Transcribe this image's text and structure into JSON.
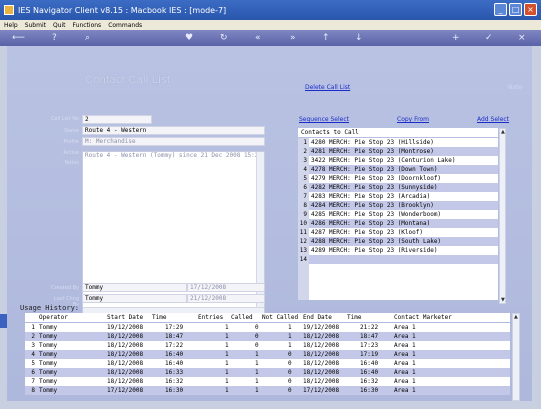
{
  "window": {
    "title": "IES Navigator Client v8.15 : Macbook IES :          [mode-7]"
  },
  "menu": [
    "Help",
    "Submit",
    "Quit",
    "Functions",
    "Commands"
  ],
  "toolbar_icons": [
    "back-icon",
    "help-icon",
    "search-icon",
    "heart-icon",
    "refresh-icon",
    "rewind-icon",
    "fast-forward-icon",
    "up-icon",
    "down-icon",
    "add-icon",
    "check-icon",
    "close-icon"
  ],
  "page": {
    "heading": "Contact Call List",
    "delete_link": "Delete Call List",
    "note_link": "Note"
  },
  "form": {
    "labels": {
      "call_list_no": "Call List No",
      "name": "Name",
      "profile": "Profile",
      "active_notes": "Active",
      "notes": "Notes",
      "created_by": "Created By",
      "last_changed_by": "Last Chng By"
    },
    "call_list_no": "2",
    "name": "Route 4 - Western",
    "profile": "M: Merchandise",
    "notes_line": "Route 4 - Western (Tommy) since 21 Dec 2008 15:25",
    "created_by": "Tommy",
    "created_date": "17/12/2008",
    "changed_by": "Tommy",
    "changed_date": "21/12/2008"
  },
  "contacts": {
    "sequence_link": "Sequence Select",
    "copy_link": "Copy From",
    "add_link": "Add Select",
    "header": "Contacts to Call",
    "rows": [
      {
        "n": "1",
        "text": "4280 MERCH: Pie Stop 23 (Hillside)"
      },
      {
        "n": "2",
        "text": "4281 MERCH: Pie Stop 23 (Montrose)"
      },
      {
        "n": "3",
        "text": "3422 MERCH: Pie Stop 23 (Centurion Lake)"
      },
      {
        "n": "4",
        "text": "4278 MERCH: Pie Stop 23 (Down Town)"
      },
      {
        "n": "5",
        "text": "4279 MERCH: Pie Stop 23 (Doornkloof)"
      },
      {
        "n": "6",
        "text": "4282 MERCH: Pie Stop 23 (Sunnyside)"
      },
      {
        "n": "7",
        "text": "4283 MERCH: Pie Stop 23 (Arcadia)"
      },
      {
        "n": "8",
        "text": "4284 MERCH: Pie Stop 23 (Brooklyn)"
      },
      {
        "n": "9",
        "text": "4285 MERCH: Pie Stop 23 (Wonderboom)"
      },
      {
        "n": "10",
        "text": "4286 MERCH: Pie Stop 23 (Montana)"
      },
      {
        "n": "11",
        "text": "4287 MERCH: Pie Stop 23 (Kloof)"
      },
      {
        "n": "12",
        "text": "4288 MERCH: Pie Stop 23 (South Lake)"
      },
      {
        "n": "13",
        "text": "4289 MERCH: Pie Stop 23 (Riverside)"
      },
      {
        "n": "14",
        "text": ""
      },
      {
        "n": "",
        "text": ""
      },
      {
        "n": "",
        "text": ""
      },
      {
        "n": "",
        "text": ""
      },
      {
        "n": "",
        "text": ""
      }
    ]
  },
  "usage": {
    "title": "Usage History:",
    "headers": {
      "operator": "Operator",
      "start_date": "Start Date",
      "time": "Time",
      "entries": "Entries",
      "called": "Called",
      "not_called": "Not Called",
      "end_date": "End Date",
      "end_time": "Time",
      "marketer": "Contact Marketer"
    },
    "rows": [
      {
        "n": "1",
        "op": "Tommy",
        "sd": "19/12/2008",
        "st": "17:29",
        "en": "1",
        "ca": "0",
        "nc": "1",
        "ed": "19/12/2008",
        "et": "21:22",
        "mk": "Area 1"
      },
      {
        "n": "2",
        "op": "Tommy",
        "sd": "18/12/2008",
        "st": "18:47",
        "en": "1",
        "ca": "0",
        "nc": "1",
        "ed": "18/12/2008",
        "et": "18:47",
        "mk": "Area 1"
      },
      {
        "n": "3",
        "op": "Tommy",
        "sd": "18/12/2008",
        "st": "17:22",
        "en": "1",
        "ca": "0",
        "nc": "1",
        "ed": "18/12/2008",
        "et": "17:23",
        "mk": "Area 1"
      },
      {
        "n": "4",
        "op": "Tommy",
        "sd": "18/12/2008",
        "st": "16:40",
        "en": "1",
        "ca": "1",
        "nc": "0",
        "ed": "18/12/2008",
        "et": "17:19",
        "mk": "Area 1"
      },
      {
        "n": "5",
        "op": "Tommy",
        "sd": "18/12/2008",
        "st": "16:40",
        "en": "1",
        "ca": "1",
        "nc": "0",
        "ed": "18/12/2008",
        "et": "16:40",
        "mk": "Area 1"
      },
      {
        "n": "6",
        "op": "Tommy",
        "sd": "18/12/2008",
        "st": "16:33",
        "en": "1",
        "ca": "1",
        "nc": "0",
        "ed": "18/12/2008",
        "et": "16:40",
        "mk": "Area 1"
      },
      {
        "n": "7",
        "op": "Tommy",
        "sd": "18/12/2008",
        "st": "16:32",
        "en": "1",
        "ca": "1",
        "nc": "0",
        "ed": "18/12/2008",
        "et": "16:32",
        "mk": "Area 1"
      },
      {
        "n": "8",
        "op": "Tommy",
        "sd": "17/12/2008",
        "st": "16:30",
        "en": "1",
        "ca": "1",
        "nc": "0",
        "ed": "17/12/2008",
        "et": "16:30",
        "mk": "Area 1"
      }
    ]
  }
}
